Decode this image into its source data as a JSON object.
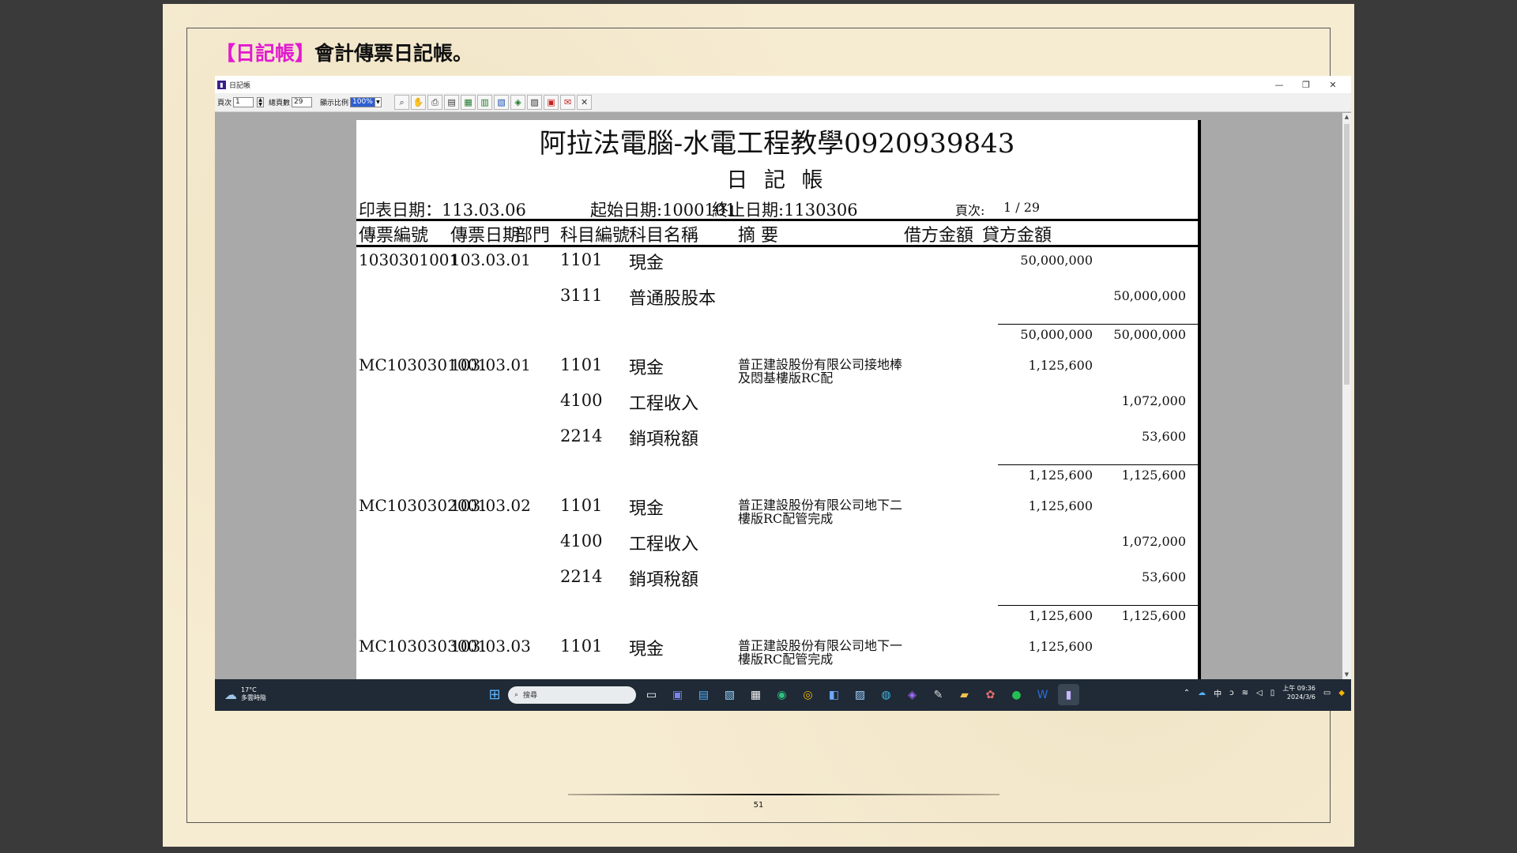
{
  "heading": {
    "tag": "【日記帳】",
    "text": "會計傳票日記帳。"
  },
  "window": {
    "title": "日記帳",
    "controls": {
      "minimize": "—",
      "restore": "❐",
      "close": "✕"
    }
  },
  "toolbar": {
    "page_label": "頁次",
    "page_value": "1",
    "total_label": "總頁數",
    "total_value": "29",
    "zoom_label": "顯示比例",
    "zoom_value": "100%",
    "icons": [
      "search-icon",
      "hand-icon",
      "print-icon",
      "page-icon",
      "export-icon",
      "excel-icon",
      "word-icon",
      "html-icon",
      "text-icon",
      "pdf-icon",
      "email-icon",
      "close-icon"
    ]
  },
  "report": {
    "company": "阿拉法電腦-水電工程教學0920939843",
    "title": "日 記 帳",
    "print_date": "印表日期：113.03.06",
    "start_date": "起始日期:1000101",
    "end_date": "終止日期:1130306",
    "page_label": "頁次:",
    "page_value": "1 / 29",
    "columns": [
      "傳票編號",
      "傳票日期",
      "部門",
      "科目編號",
      "科目名稱",
      "摘 要",
      "借方金額",
      "貸方金額"
    ],
    "vouchers": [
      {
        "no": "1030301001",
        "date": "103.03.01",
        "entries": [
          {
            "code": "1101",
            "name": "現金",
            "memo": "",
            "debit": "50,000,000",
            "credit": ""
          },
          {
            "code": "3111",
            "name": "普通股股本",
            "memo": "",
            "debit": "",
            "credit": "50,000,000"
          }
        ],
        "total_debit": "50,000,000",
        "total_credit": "50,000,000"
      },
      {
        "no": "MC1030301001",
        "date": "103.03.01",
        "entries": [
          {
            "code": "1101",
            "name": "現金",
            "memo": "普正建設股份有限公司接地棒及悶基樓版RC配",
            "debit": "1,125,600",
            "credit": ""
          },
          {
            "code": "4100",
            "name": "工程收入",
            "memo": "",
            "debit": "",
            "credit": "1,072,000"
          },
          {
            "code": "2214",
            "name": "銷項稅額",
            "memo": "",
            "debit": "",
            "credit": "53,600"
          }
        ],
        "total_debit": "1,125,600",
        "total_credit": "1,125,600"
      },
      {
        "no": "MC1030302001",
        "date": "103.03.02",
        "entries": [
          {
            "code": "1101",
            "name": "現金",
            "memo": "普正建設股份有限公司地下二樓版RC配管完成",
            "debit": "1,125,600",
            "credit": ""
          },
          {
            "code": "4100",
            "name": "工程收入",
            "memo": "",
            "debit": "",
            "credit": "1,072,000"
          },
          {
            "code": "2214",
            "name": "銷項稅額",
            "memo": "",
            "debit": "",
            "credit": "53,600"
          }
        ],
        "total_debit": "1,125,600",
        "total_credit": "1,125,600"
      },
      {
        "no": "MC1030303001",
        "date": "103.03.03",
        "entries": [
          {
            "code": "1101",
            "name": "現金",
            "memo": "普正建設股份有限公司地下一樓版RC配管完成",
            "debit": "1,125,600",
            "credit": ""
          }
        ]
      }
    ]
  },
  "taskbar": {
    "temp": "17°C",
    "weather": "多雲時陰",
    "search_placeholder": "搜尋",
    "ime": "中",
    "time": "上午 09:36",
    "date": "2024/3/6"
  },
  "slide_page": "51"
}
